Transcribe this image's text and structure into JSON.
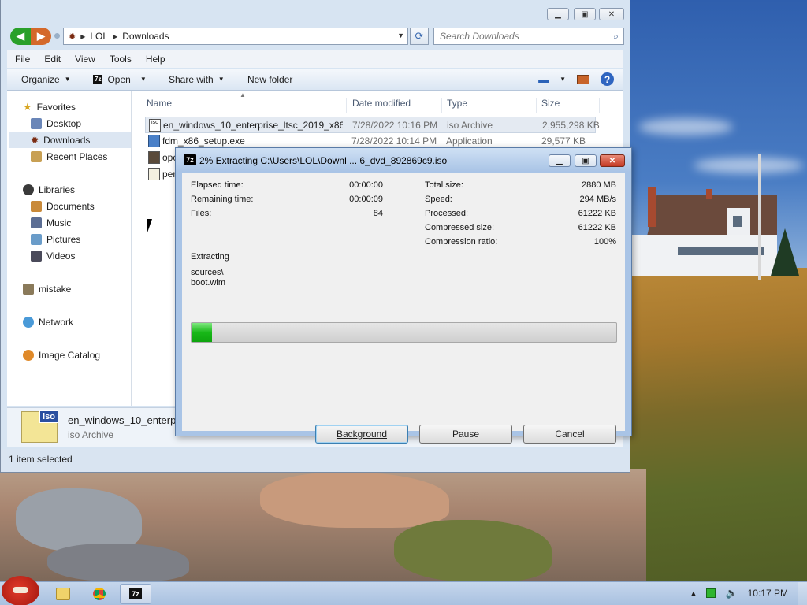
{
  "explorer": {
    "breadcrumb": [
      "LOL",
      "Downloads"
    ],
    "search_placeholder": "Search Downloads",
    "menu": [
      "File",
      "Edit",
      "View",
      "Tools",
      "Help"
    ],
    "toolbar": {
      "organize": "Organize",
      "open": "Open",
      "share_with": "Share with",
      "new_folder": "New folder"
    },
    "sidebar": {
      "favorites": "Favorites",
      "desktop": "Desktop",
      "downloads": "Downloads",
      "recent_places": "Recent Places",
      "libraries": "Libraries",
      "documents": "Documents",
      "music": "Music",
      "pictures": "Pictures",
      "videos": "Videos",
      "mistake": "mistake",
      "network": "Network",
      "image_catalog": "Image Catalog"
    },
    "columns": {
      "name": "Name",
      "date_modified": "Date modified",
      "type": "Type",
      "size": "Size"
    },
    "files": [
      {
        "name": "en_windows_10_enterprise_ltsc_2019_x86...",
        "date": "7/28/2022 10:16 PM",
        "type": "iso Archive",
        "size": "2,955,298 KB"
      },
      {
        "name": "fdm_x86_setup.exe",
        "date": "7/28/2022 10:14 PM",
        "type": "Application",
        "size": "29,577 KB"
      },
      {
        "name": "ope",
        "date": "",
        "type": "",
        "size": ""
      },
      {
        "name": "per",
        "date": "",
        "type": "",
        "size": ""
      }
    ],
    "details": {
      "name": "en_windows_10_enterpri",
      "type": "iso Archive",
      "icon_text": "iso"
    },
    "status": "1 item selected"
  },
  "dialog": {
    "app_icon": "7z",
    "title": "2% Extracting C:\\Users\\LOL\\Downl ... 6_dvd_892869c9.iso",
    "left": [
      {
        "label": "Elapsed time:",
        "value": "00:00:00"
      },
      {
        "label": "Remaining time:",
        "value": "00:00:09"
      },
      {
        "label": "Files:",
        "value": "84"
      }
    ],
    "right": [
      {
        "label": "Total size:",
        "value": "2880 MB"
      },
      {
        "label": "Speed:",
        "value": "294 MB/s"
      },
      {
        "label": "Processed:",
        "value": "61222 KB"
      },
      {
        "label": "Compressed size:",
        "value": "61222 KB"
      },
      {
        "label": "Compression ratio:",
        "value": "100%"
      }
    ],
    "action": "Extracting",
    "path_line1": "sources\\",
    "path_line2": "boot.wim",
    "progress_percent": 2,
    "buttons": {
      "background": "Background",
      "pause": "Pause",
      "cancel": "Cancel"
    }
  },
  "taskbar": {
    "active_item": "7z",
    "clock": "10:17 PM"
  },
  "colors": {
    "progress": "#18b818",
    "dialog_frame": "#a9c4e6",
    "taskbar": "#b8cbe4"
  }
}
